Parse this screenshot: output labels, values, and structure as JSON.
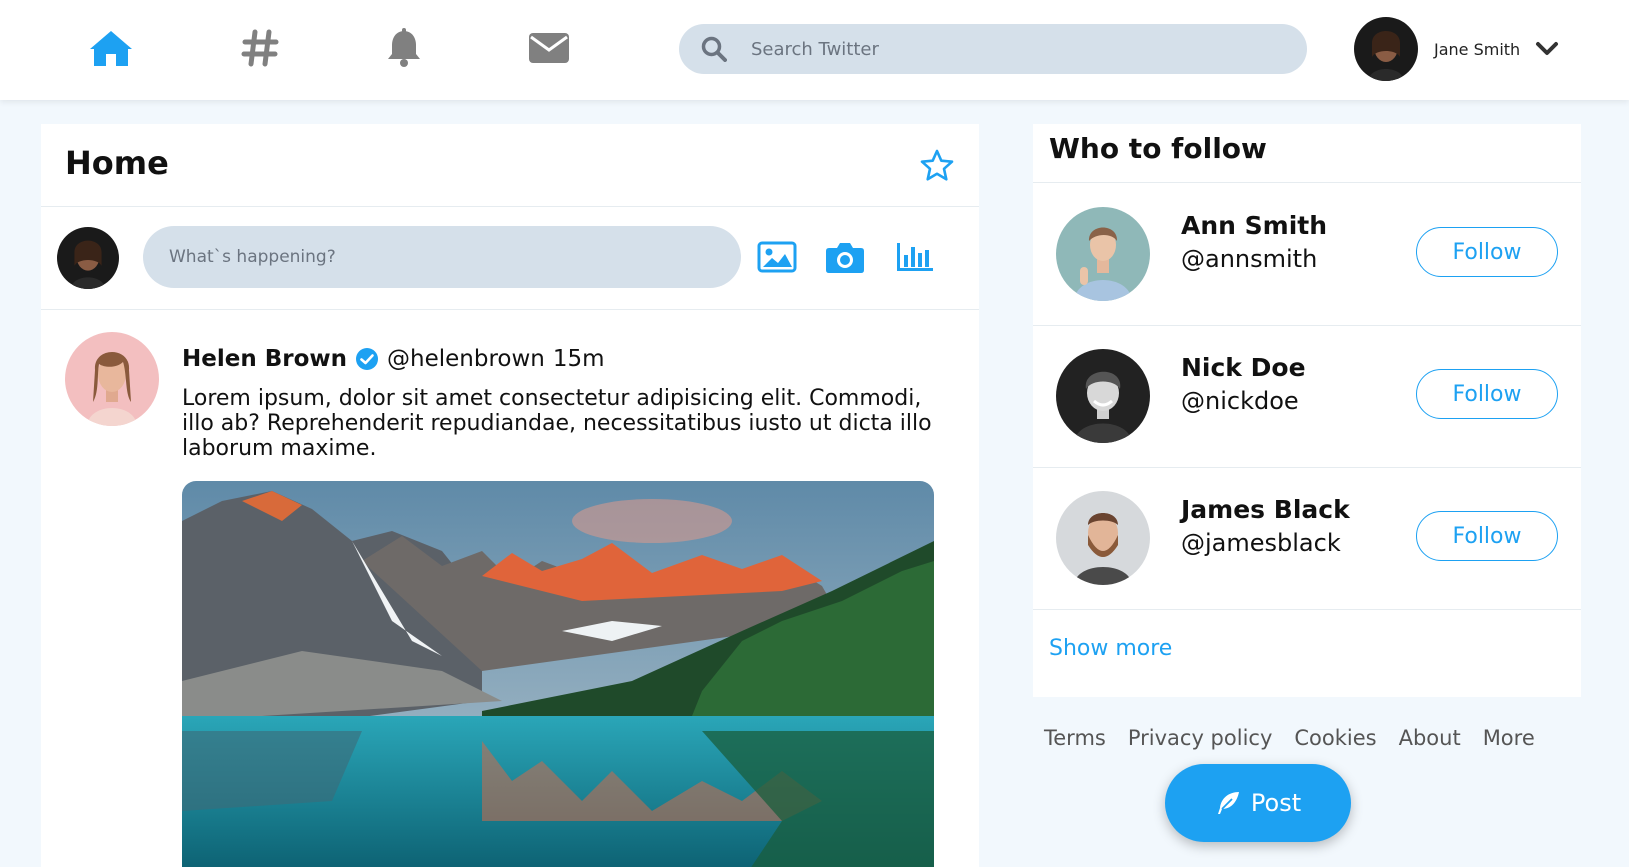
{
  "theme": {
    "accent": "#1da1f2",
    "page_bg": "#f2f8fd",
    "input_bg": "#d5e0ea",
    "icon_gray": "#808080"
  },
  "nav": {
    "icons": [
      "home-icon",
      "hashtag-icon",
      "bell-icon",
      "mail-icon"
    ],
    "active": "home-icon"
  },
  "search": {
    "placeholder": "Search Twitter"
  },
  "profile": {
    "name": "Jane Smith"
  },
  "feed": {
    "title": "Home",
    "composer_placeholder": "What`s happening?",
    "post": {
      "author": "Helen Brown",
      "handle": "@helenbrown",
      "time": "15m",
      "text": "Lorem ipsum, dolor sit amet consectetur adipisicing elit. Commodi, illo ab? Reprehenderit repudiandae, necessitatibus iusto ut dicta illo laborum maxime."
    }
  },
  "who_to_follow": {
    "title": "Who to follow",
    "users": [
      {
        "name": "Ann Smith",
        "handle": "@annsmith",
        "button": "Follow"
      },
      {
        "name": "Nick Doe",
        "handle": "@nickdoe",
        "button": "Follow"
      },
      {
        "name": "James Black",
        "handle": "@jamesblack",
        "button": "Follow"
      }
    ],
    "show_more": "Show more"
  },
  "footer": {
    "links": [
      "Terms",
      "Privacy policy",
      "Cookies",
      "About",
      "More"
    ]
  },
  "post_button": {
    "label": "Post"
  }
}
